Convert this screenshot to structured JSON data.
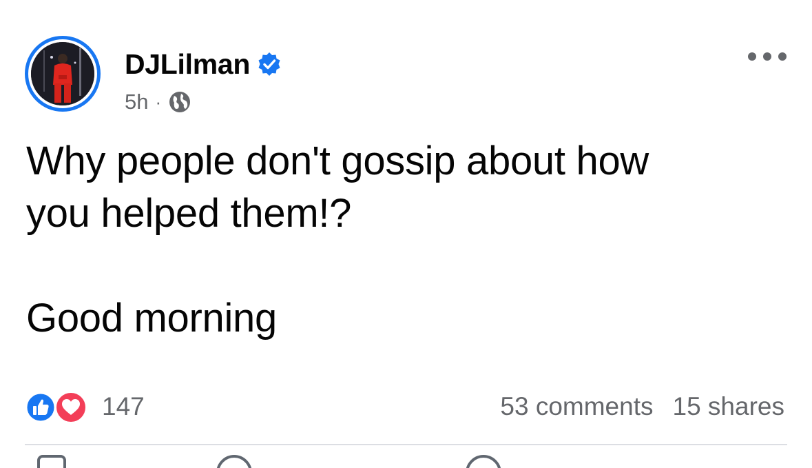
{
  "post": {
    "author": "DJLilman",
    "verified": true,
    "time": "5h",
    "separator": "·",
    "audience_icon": "globe-icon",
    "more_icon": "more-options-icon",
    "text_lines": [
      "Why people don't gossip about how",
      "you helped them!?",
      "",
      "Good morning"
    ],
    "reactions": {
      "icons": [
        "like-icon",
        "love-icon"
      ],
      "count": "147"
    },
    "comments": "53 comments",
    "shares": "15 shares"
  },
  "colors": {
    "brand_blue": "#1877f2",
    "love_red": "#f33e58",
    "secondary_text": "#65676b",
    "primary_text": "#050505",
    "divider": "#dcdee3"
  }
}
